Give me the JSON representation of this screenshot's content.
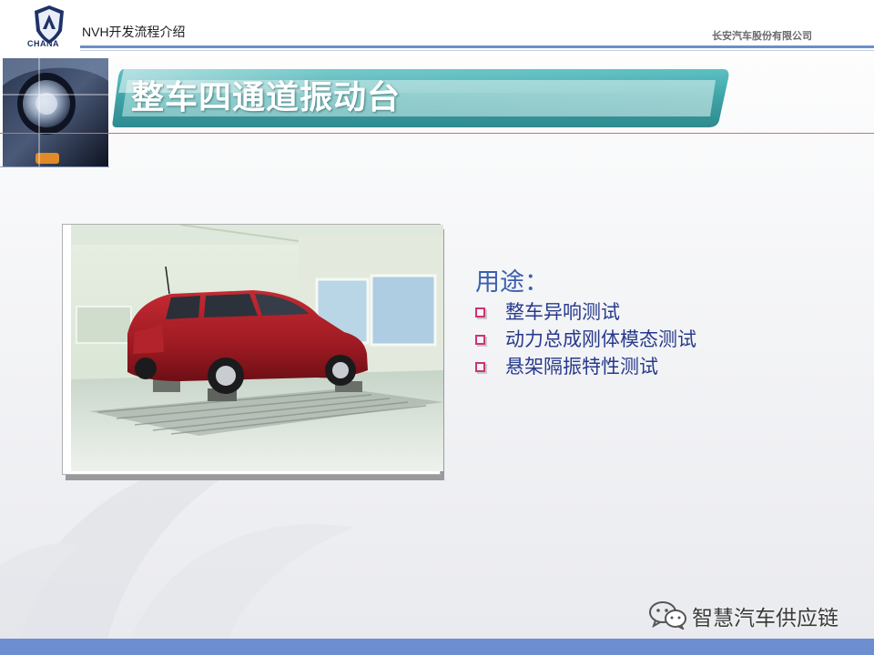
{
  "header": {
    "logo_text": "CHANA",
    "left_text": "NVH开发流程介绍",
    "right_text": "长安汽车股份有限公司"
  },
  "slide": {
    "title": "整车四通道振动台"
  },
  "usage": {
    "heading": "用途：",
    "items": [
      "整车异响测试",
      "动力总成刚体模态测试",
      "悬架隔振特性测试"
    ]
  },
  "watermark": {
    "account": "智慧汽车供应链"
  },
  "colors": {
    "banner_teal": "#3ea3a6",
    "title_text": "#ffffff",
    "heading_blue": "#3b5fae",
    "list_text": "#273a8c",
    "bullet_pink": "#cc3377",
    "footer_bar": "#6d8fd2"
  },
  "icons": {
    "logo": "chana-shield-logo",
    "bullet": "hollow-square-bullet",
    "footer": "wechat-icon"
  }
}
